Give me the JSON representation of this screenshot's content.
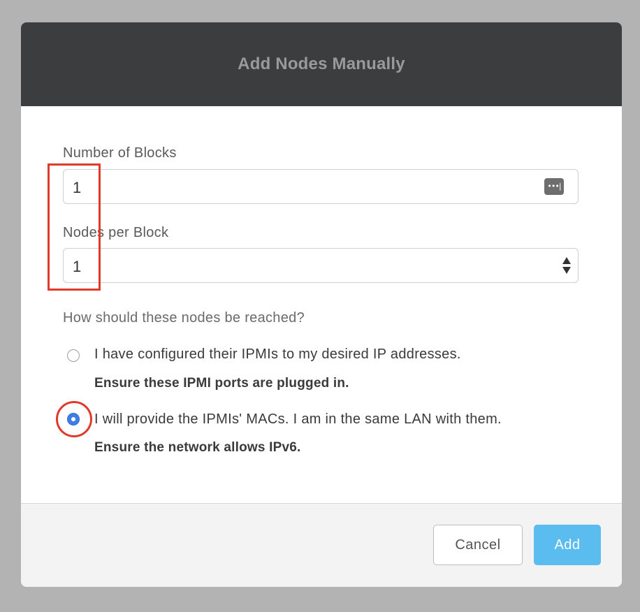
{
  "dialog": {
    "title": "Add Nodes Manually"
  },
  "fields": {
    "blocks": {
      "label": "Number of Blocks",
      "value": "1",
      "icon": "password-manager-icon"
    },
    "nodes": {
      "label": "Nodes per Block",
      "value": "1",
      "icon": "stepper-icon"
    }
  },
  "reach": {
    "question": "How should these nodes be reached?",
    "options": [
      {
        "label": "I have configured their IPMIs to my desired IP addresses.",
        "note": "Ensure these IPMI ports are plugged in.",
        "selected": false
      },
      {
        "label": "I will provide the IPMIs' MACs. I am in the same LAN with them.",
        "note": "Ensure the network allows IPv6.",
        "selected": true
      }
    ]
  },
  "footer": {
    "cancel_label": "Cancel",
    "add_label": "Add"
  },
  "colors": {
    "header_bg": "#3c3d3e",
    "accent": "#5bbcef",
    "radio_selected": "#3d7ee8",
    "annotation": "#e03a2a"
  }
}
